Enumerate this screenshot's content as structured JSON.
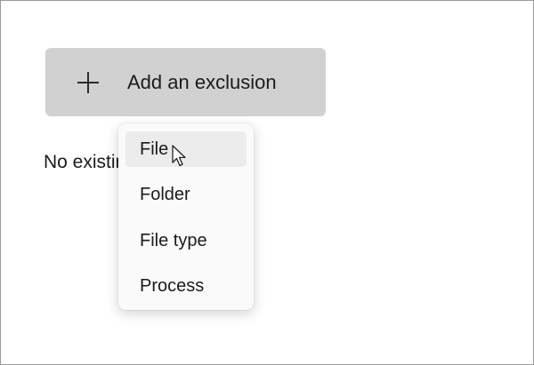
{
  "exclusions": {
    "add_button_label": "Add an exclusion",
    "add_icon": "plus-icon",
    "empty_message": "No existing exclusions."
  },
  "menu": {
    "items": [
      {
        "label": "File",
        "hovered": true
      },
      {
        "label": "Folder",
        "hovered": false
      },
      {
        "label": "File type",
        "hovered": false
      },
      {
        "label": "Process",
        "hovered": false
      }
    ]
  },
  "colors": {
    "button_bg": "#d1d1d1",
    "menu_bg": "#fafafa",
    "hover_bg": "#ececec",
    "text": "#1b1b1b"
  }
}
